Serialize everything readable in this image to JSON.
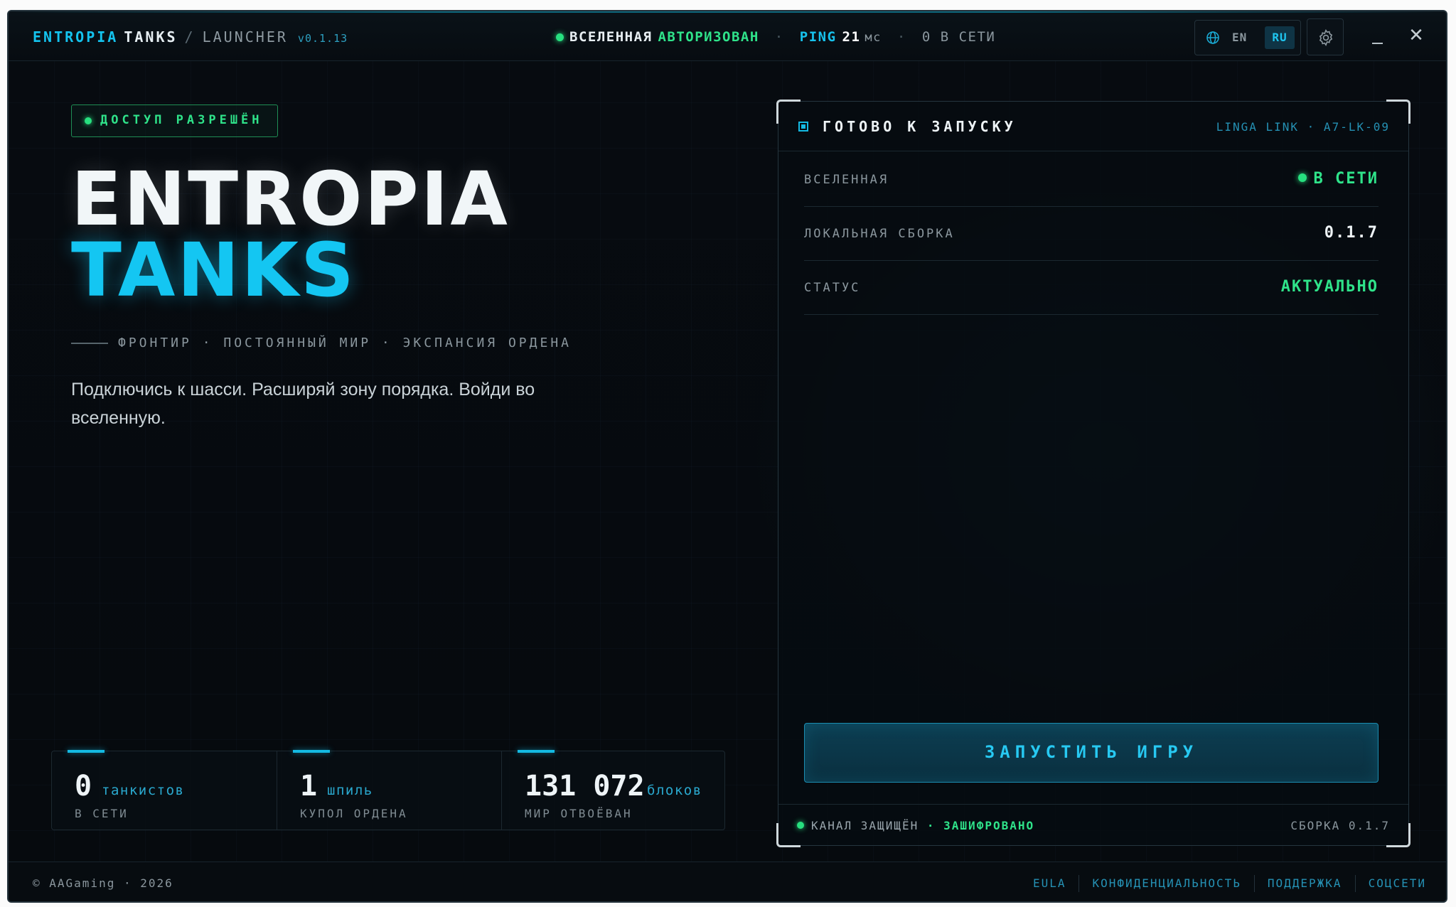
{
  "titlebar": {
    "brand_primary": "ENTROPIA",
    "brand_secondary": "TANKS",
    "separator": "/",
    "app_name": "LAUNCHER",
    "version": "v0.1.13",
    "universe_label": "ВСЕЛЕННАЯ",
    "universe_status": "АВТОРИЗОВАН",
    "middot": "·",
    "ping_label": "PING",
    "ping_value": "21",
    "ping_unit": "мс",
    "online_text": "0 В СЕТИ",
    "lang_en": "EN",
    "lang_ru": "RU",
    "active_lang": "RU",
    "minimize_icon": "minimize-icon",
    "close_glyph": "✕"
  },
  "hero": {
    "access_badge": "ДОСТУП РАЗРЕШЁН",
    "title_line1": "ENTROPIA",
    "title_line2": "TANKS",
    "tagline": "ФРОНТИР · ПОСТОЯННЫЙ МИР · ЭКСПАНСИЯ ОРДЕНА",
    "description": "Подключись к шасси. Расширяй зону порядка. Войди во вселенную."
  },
  "stats": [
    {
      "value": "0",
      "unit": "танкистов",
      "label": "В СЕТИ"
    },
    {
      "value": "1",
      "unit": "шпиль",
      "label": "КУПОЛ ОРДЕНА"
    },
    {
      "value": "131 072",
      "unit": "блоков",
      "label": "МИР ОТВОЁВАН"
    }
  ],
  "panel": {
    "title": "ГОТОВО К ЗАПУСКУ",
    "link_id": "LINGA LINK · A7-LK-09",
    "rows": [
      {
        "key": "ВСЕЛЕННАЯ",
        "value": "В СЕТИ"
      },
      {
        "key": "ЛОКАЛЬНАЯ СБОРКА",
        "value": "0.1.7"
      },
      {
        "key": "СТАТУС",
        "value": "АКТУАЛЬНО"
      }
    ],
    "launch_button": "ЗАПУСТИТЬ ИГРУ",
    "channel_text": "КАНАЛ ЗАЩИЩЁН",
    "channel_sep": "·",
    "channel_status": "ЗАШИФРОВАНО",
    "build_text": "СБОРКА 0.1.7"
  },
  "footer": {
    "copyright": "© AAGaming · 2026",
    "links": [
      "EULA",
      "КОНФИДЕНЦИАЛЬНОСТЬ",
      "ПОДДЕРЖКА",
      "СОЦСЕТИ"
    ]
  },
  "colors": {
    "accent_cyan": "#14c3ee",
    "status_green": "#2fe38a",
    "background": "#070b10"
  }
}
